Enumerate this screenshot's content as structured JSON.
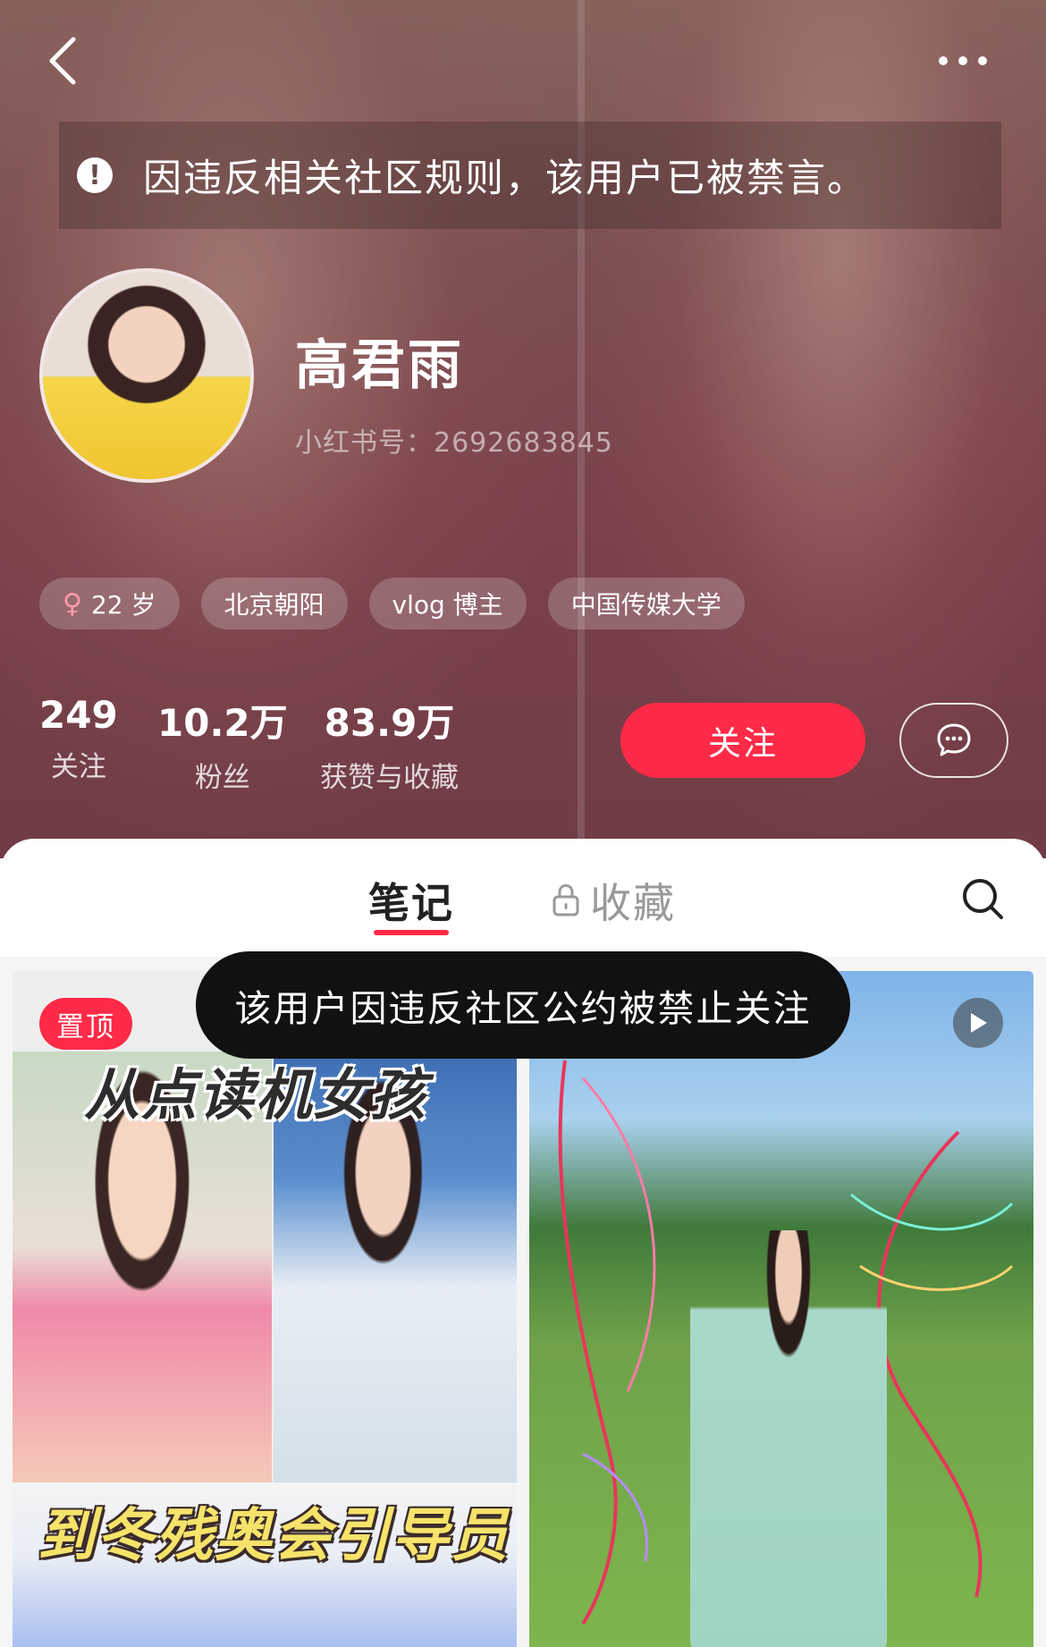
{
  "notice": {
    "text": "因违反相关社区规则，该用户已被禁言。",
    "icon": "exclamation-icon"
  },
  "profile": {
    "name": "高君雨",
    "id_text": "小红书号：2692683845"
  },
  "tags": [
    {
      "icon": "female-icon",
      "label": "22 岁"
    },
    {
      "label": "北京朝阳"
    },
    {
      "label": "vlog 博主"
    },
    {
      "label": "中国传媒大学"
    }
  ],
  "stats": [
    {
      "value": "249",
      "label": "关注"
    },
    {
      "value": "10.2万",
      "label": "粉丝"
    },
    {
      "value": "83.9万",
      "label": "获赞与收藏"
    }
  ],
  "actions": {
    "follow_label": "关注",
    "message_icon": "chat-bubble-icon"
  },
  "tabs": {
    "notes": "笔记",
    "collections": "收藏",
    "collections_icon": "lock-icon"
  },
  "toast": "该用户因违反社区公约被禁止关注",
  "cards": [
    {
      "badge": "置顶",
      "title_top": "从点读机女孩",
      "title_bottom": "到冬残奥会引导员"
    },
    {
      "media": "video",
      "icon": "play-icon"
    }
  ],
  "colors": {
    "accent": "#ff2a47",
    "header": "#8a4e57",
    "toast_bg": "#111111"
  }
}
